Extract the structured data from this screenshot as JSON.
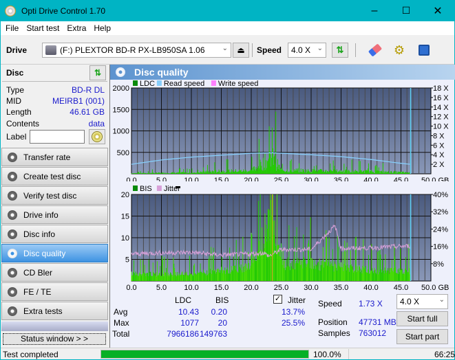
{
  "window": {
    "title": "Opti Drive Control 1.70",
    "minimize": "–",
    "maximize": "☐",
    "close": "✕"
  },
  "menu": [
    "File",
    "Start test",
    "Extra",
    "Help"
  ],
  "toolbar": {
    "drive_label": "Drive",
    "drive_value": "(F:)  PLEXTOR BD-R  PX-LB950SA 1.06",
    "speed_label": "Speed",
    "speed_value": "4.0 X"
  },
  "disc": {
    "header": "Disc",
    "rows": [
      {
        "key": "Type",
        "value": "BD-R DL"
      },
      {
        "key": "MID",
        "value": "MEIRB1 (001)"
      },
      {
        "key": "Length",
        "value": "46.61 GB"
      },
      {
        "key": "Contents",
        "value": "data"
      }
    ],
    "label_key": "Label",
    "label_value": ""
  },
  "nav": [
    {
      "label": "Transfer rate",
      "active": false
    },
    {
      "label": "Create test disc",
      "active": false
    },
    {
      "label": "Verify test disc",
      "active": false
    },
    {
      "label": "Drive info",
      "active": false
    },
    {
      "label": "Disc info",
      "active": false
    },
    {
      "label": "Disc quality",
      "active": true
    },
    {
      "label": "CD Bler",
      "active": false
    },
    {
      "label": "FE / TE",
      "active": false
    },
    {
      "label": "Extra tests",
      "active": false
    }
  ],
  "status_window_button": "Status window > >",
  "panel_title": "Disc quality",
  "chart_data": [
    {
      "type": "bar",
      "legend": [
        "LDC",
        "Read speed",
        "Write speed"
      ],
      "legend_colors": [
        "#0a8a0a",
        "#87cefa",
        "#ff80ff"
      ],
      "legend_placement": "top-left",
      "xlabel": "GB",
      "xlim": [
        0,
        50
      ],
      "x_ticks": [
        "0.0",
        "5.0",
        "10.0",
        "15.0",
        "20.0",
        "25.0",
        "30.0",
        "35.0",
        "40.0",
        "45.0",
        "50.0 GB"
      ],
      "ylim": [
        0,
        2000
      ],
      "y_ticks": [
        "500",
        "1000",
        "1500",
        "2000"
      ],
      "y2lim": [
        0,
        18
      ],
      "y2_ticks": [
        "2 X",
        "4 X",
        "6 X",
        "8 X",
        "10 X",
        "12 X",
        "14 X",
        "16 X",
        "18 X"
      ],
      "grid": true,
      "ldc_profile": {
        "x": [
          0,
          5,
          10,
          15,
          20,
          23.5,
          25,
          30,
          35,
          40,
          46.6
        ],
        "y": [
          40,
          60,
          80,
          180,
          200,
          1077,
          250,
          200,
          180,
          150,
          80
        ]
      },
      "read_speed": {
        "x": [
          0,
          5,
          10,
          15,
          20,
          23.5,
          30,
          35,
          40,
          45,
          46.6
        ],
        "y": [
          2.0,
          2.9,
          3.5,
          3.9,
          4.3,
          4.4,
          4.0,
          3.6,
          3.0,
          2.2,
          2.0
        ]
      },
      "end_marker_gb": 46.61
    },
    {
      "type": "bar",
      "legend": [
        "BIS",
        "Jitter"
      ],
      "legend_colors": [
        "#0a8a0a",
        "#d8a0d8"
      ],
      "legend_placement": "top-left",
      "xlabel": "GB",
      "xlim": [
        0,
        50
      ],
      "x_ticks": [
        "0.0",
        "5.0",
        "10.0",
        "15.0",
        "20.0",
        "25.0",
        "30.0",
        "35.0",
        "40.0",
        "45.0",
        "50.0 GB"
      ],
      "ylim": [
        0,
        20
      ],
      "y_ticks": [
        "5",
        "10",
        "15",
        "20"
      ],
      "y2lim": [
        0,
        40
      ],
      "y2_ticks": [
        "8%",
        "16%",
        "24%",
        "32%",
        "40%"
      ],
      "grid": true,
      "bis_profile": {
        "x": [
          0,
          10,
          15,
          20,
          23.5,
          25,
          30,
          35,
          40,
          46.6
        ],
        "y": [
          2,
          2,
          3,
          4,
          20,
          5,
          5,
          4,
          3,
          3
        ]
      },
      "jitter": {
        "x": [
          0,
          5,
          10,
          15,
          20,
          22,
          23,
          25,
          30,
          34,
          35,
          40,
          45,
          46.6
        ],
        "y": [
          12.5,
          13,
          13.2,
          12,
          12.5,
          13,
          11.5,
          14.5,
          14.6,
          25.5,
          15,
          15.3,
          16,
          16.2
        ]
      },
      "end_marker_gb": 46.61,
      "marker_23_5_gb": 23.5
    }
  ],
  "stats": {
    "col_ldc": "LDC",
    "col_bis": "BIS",
    "jitter_label": "Jitter",
    "jitter_checked": true,
    "rows": [
      {
        "label": "Avg",
        "ldc": "10.43",
        "bis": "0.20",
        "jitter": "13.7%"
      },
      {
        "label": "Max",
        "ldc": "1077",
        "bis": "20",
        "jitter": "25.5%"
      },
      {
        "label": "Total",
        "ldc": "7966186",
        "bis": "149763",
        "jitter": ""
      }
    ],
    "speed_label": "Speed",
    "speed_value": "1.73 X",
    "position_label": "Position",
    "position_value": "47731 MB",
    "samples_label": "Samples",
    "samples_value": "763012",
    "speed_select": "4.0 X",
    "start_full": "Start full",
    "start_part": "Start part"
  },
  "statusbar": {
    "text": "Test completed",
    "progress": 100.0,
    "progress_text": "100.0%",
    "time": "66:25"
  }
}
